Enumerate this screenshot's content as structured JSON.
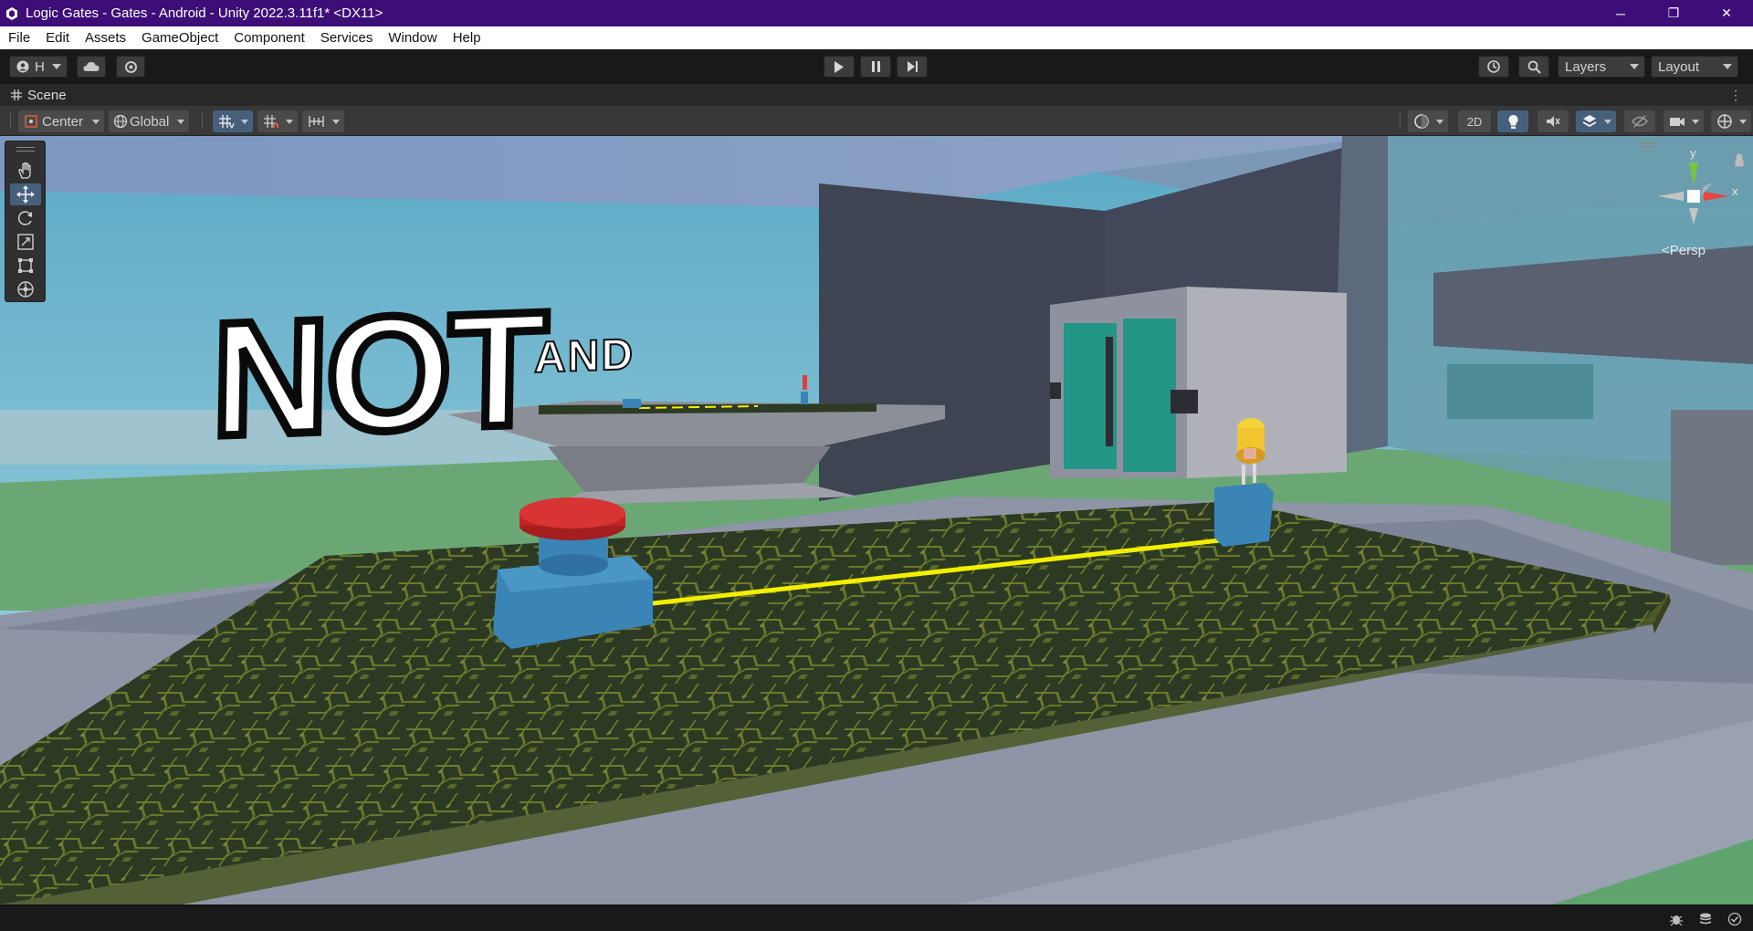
{
  "window": {
    "title": "Logic Gates - Gates - Android - Unity 2022.3.11f1* <DX11>",
    "controls": {
      "minimize": "─",
      "maximize": "❐",
      "close": "✕"
    }
  },
  "menu": [
    "File",
    "Edit",
    "Assets",
    "GameObject",
    "Component",
    "Services",
    "Window",
    "Help"
  ],
  "toolbar": {
    "account_label": "H",
    "layers_label": "Layers",
    "layout_label": "Layout"
  },
  "scene_tab": {
    "label": "Scene"
  },
  "scene_toolbar": {
    "pivot_label": "Center",
    "space_label": "Global",
    "mode_2d_label": "2D"
  },
  "viewport": {
    "sign_big": "NOT",
    "sign_behind": "AND",
    "persp_label": "<Persp",
    "gizmo_axes": {
      "y": "y",
      "x": "x"
    }
  },
  "colors": {
    "titlebar": "#3d0e78",
    "accent_active": "#46607c",
    "wire": "#f2ee00",
    "button_red": "#c42424",
    "button_base": "#3b84b6",
    "pcb": "#2d3a24"
  }
}
